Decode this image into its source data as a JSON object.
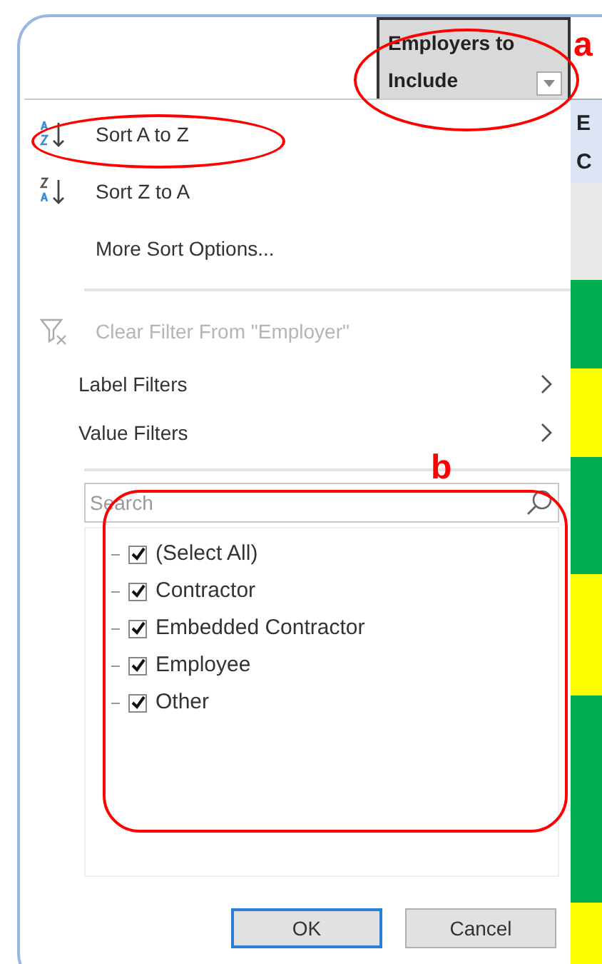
{
  "header_cell": {
    "label": "Employers to Include"
  },
  "side_header": {
    "lines": [
      "E",
      "C"
    ]
  },
  "bands": [
    {
      "color": "#00b050"
    },
    {
      "color": "#ffff00"
    },
    {
      "color": "#00b050"
    },
    {
      "color": "#ffff00"
    },
    {
      "color": "#00b050"
    },
    {
      "color": "#ffff00"
    }
  ],
  "menu": [
    {
      "kind": "sort-asc",
      "label": "Sort A to Z",
      "disabled": false
    },
    {
      "kind": "sort-desc",
      "label": "Sort Z to A",
      "disabled": false
    },
    {
      "kind": "plain",
      "label": "More Sort Options...",
      "disabled": false
    },
    {
      "kind": "separator"
    },
    {
      "kind": "clear",
      "label": "Clear Filter From \"Employer\"",
      "disabled": true
    },
    {
      "kind": "submenu",
      "label": "Label Filters",
      "disabled": false
    },
    {
      "kind": "submenu",
      "label": "Value Filters",
      "disabled": false
    },
    {
      "kind": "separator"
    }
  ],
  "search": {
    "placeholder": "Search"
  },
  "values": [
    {
      "label": "(Select All)",
      "checked": true
    },
    {
      "label": "Contractor",
      "checked": true
    },
    {
      "label": "Embedded Contractor",
      "checked": true
    },
    {
      "label": "Employee",
      "checked": true
    },
    {
      "label": "Other",
      "checked": true
    }
  ],
  "buttons": [
    {
      "label": "OK",
      "selected": true
    },
    {
      "label": "Cancel",
      "selected": false
    }
  ],
  "annotations": [
    "a",
    "b"
  ]
}
